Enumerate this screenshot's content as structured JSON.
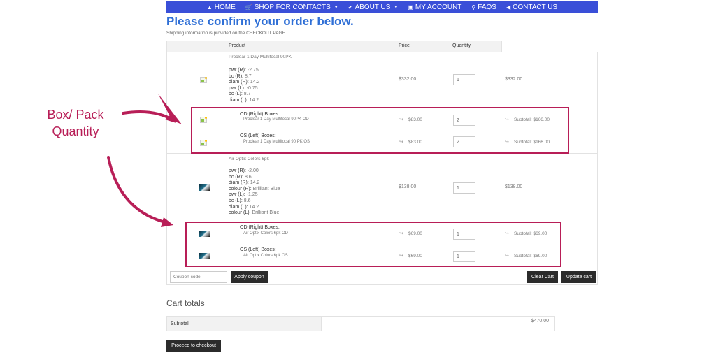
{
  "nav": {
    "items": [
      {
        "label": "HOME",
        "icon": "home-icon"
      },
      {
        "label": "SHOP FOR CONTACTS",
        "icon": "cart-icon"
      },
      {
        "label": "ABOUT US",
        "icon": "check-icon"
      },
      {
        "label": "MY ACCOUNT",
        "icon": "account-icon"
      },
      {
        "label": "FAQS",
        "icon": "search-icon"
      },
      {
        "label": "CONTACT US",
        "icon": "megaphone-icon"
      }
    ],
    "color": "#3a4fd8"
  },
  "page": {
    "title": "Please confirm your order below.",
    "note": "Shipping information is provided on the CHECKOUT PAGE."
  },
  "table": {
    "headers": {
      "product": "Product",
      "price": "Price",
      "quantity": "Quantity"
    },
    "products": [
      {
        "name": "Proclear 1 Day Multifocal 90PK",
        "attrs": [
          {
            "k": "pwr (R):",
            "v": "-2.75"
          },
          {
            "k": "bc (R):",
            "v": "8.7"
          },
          {
            "k": "diam (R):",
            "v": "14.2"
          },
          {
            "k": "pwr (L):",
            "v": "-0.75"
          },
          {
            "k": "bc (L):",
            "v": "8.7"
          },
          {
            "k": "diam (L):",
            "v": "14.2"
          }
        ],
        "price": "$332.00",
        "qty": "1",
        "total": "$332.00",
        "boxes": [
          {
            "title": "OD (Right) Boxes:",
            "name": "Proclear 1 Day Multifocal 90PK OD",
            "price": "$83.00",
            "qty": "2",
            "subtotal": "Subtotal: $166.00"
          },
          {
            "title": "OS (Left) Boxes:",
            "name": "Proclear 1 Day Multifocal 90 PK OS",
            "price": "$83.00",
            "qty": "2",
            "subtotal": "Subtotal: $166.00"
          }
        ]
      },
      {
        "name": "Air Optix Colors 6pk",
        "attrs": [
          {
            "k": "pwr (R):",
            "v": "-2.00"
          },
          {
            "k": "bc (R):",
            "v": "8.6"
          },
          {
            "k": "diam (R):",
            "v": "14.2"
          },
          {
            "k": "colour (R):",
            "v": "Brilliant Blue"
          },
          {
            "k": "pwr (L):",
            "v": "-1.25"
          },
          {
            "k": "bc (L):",
            "v": "8.6"
          },
          {
            "k": "diam (L):",
            "v": "14.2"
          },
          {
            "k": "colour (L):",
            "v": "Brilliant Blue"
          }
        ],
        "price": "$138.00",
        "qty": "1",
        "total": "$138.00",
        "boxes": [
          {
            "title": "OD (Right) Boxes:",
            "name": "Air Optix Colors 6pk OD",
            "price": "$69.00",
            "qty": "1",
            "subtotal": "Subtotal: $69.00"
          },
          {
            "title": "OS (Left) Boxes:",
            "name": "Air Optix Colors 6pk OS",
            "price": "$69.00",
            "qty": "1",
            "subtotal": "Subtotal: $69.00"
          }
        ]
      }
    ],
    "coupon_placeholder": "Coupon code",
    "apply_coupon": "Apply coupon",
    "clear_cart": "Clear Cart",
    "update_cart": "Update cart"
  },
  "annotation": {
    "line1": "Box/ Pack",
    "line2": "Quantity",
    "color": "#b81e57"
  },
  "totals": {
    "heading": "Cart totals",
    "subtotal_label": "Subtotal",
    "subtotal_value": "$470.00",
    "checkout": "Proceed to checkout"
  }
}
